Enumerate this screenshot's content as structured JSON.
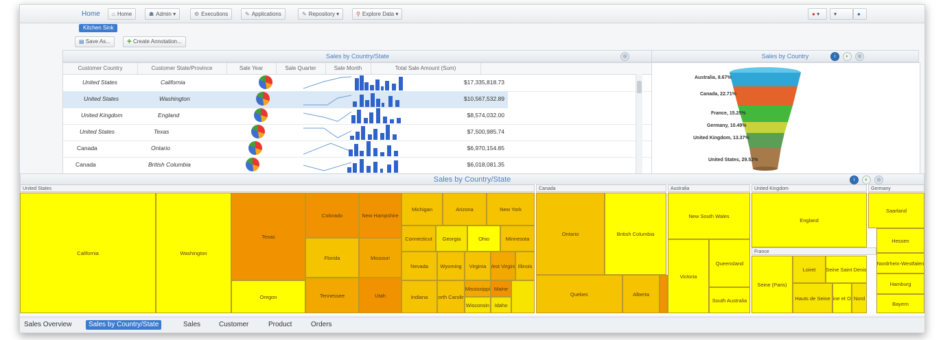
{
  "app": {
    "brand": "Home"
  },
  "nav": {
    "home": "Home",
    "admin": "Admin",
    "executions": "Executions",
    "applications": "Applications",
    "repository": "Repository",
    "explore": "Explore Data"
  },
  "kitchen_sink": "Kitchen Sink",
  "toolbar": {
    "save_as": "Save As...",
    "create_annotation": "Create Annotation..."
  },
  "grid_panel": {
    "title": "Sales by Country/State",
    "columns": [
      "Customer Country",
      "Customer State/Province",
      "Sale Year",
      "Sale Quarter",
      "Sale Month",
      "Total Sale Amount (Sum)"
    ],
    "rows": [
      {
        "country": "United States",
        "state": "California",
        "amount": "$17,335,818.73"
      },
      {
        "country": "United States",
        "state": "Washington",
        "amount": "$10,567,532.89"
      },
      {
        "country": "United Kingdom",
        "state": "England",
        "amount": "$8,574,032.00"
      },
      {
        "country": "United States",
        "state": "Texas",
        "amount": "$7,500,985.74"
      },
      {
        "country": "Canada",
        "state": "Ontario",
        "amount": "$6,970,154.85"
      },
      {
        "country": "Canada",
        "state": "British Columbia",
        "amount": "$6,018,081.35"
      }
    ]
  },
  "funnel_panel": {
    "title": "Sales by Country",
    "labels": [
      "Australia, 8.67%",
      "Canada, 22.71%",
      "France, 15.25%",
      "Germany, 10.49%",
      "United Kingdom, 13.37%",
      "United States, 29.52%"
    ],
    "colors": [
      "#2fa7d6",
      "#e3632b",
      "#44b83c",
      "#c7d33a",
      "#5b9e55",
      "#a77a4a"
    ]
  },
  "treemap_panel": {
    "title": "Sales by Country/State",
    "groups": [
      "United States",
      "Canada",
      "Australia",
      "United Kingdom",
      "Germany",
      "France"
    ],
    "cells": {
      "california": "California",
      "washington": "Washington",
      "texas": "Texas",
      "oregon": "Oregon",
      "colorado": "Colorado",
      "new_hampshire": "New Hampshire",
      "florida": "Florida",
      "missouri": "Missouri",
      "tennessee": "Tennessee",
      "utah": "Utah",
      "michigan": "Michigan",
      "arizona": "Arizona",
      "new_york": "New York",
      "connecticut": "Connecticut",
      "georgia": "Georgia",
      "ohio": "Ohio",
      "minnesota": "Minnesota",
      "nevada": "Nevada",
      "wyoming": "Wyoming",
      "virginia": "Virginia",
      "west_virginia": "West Virginia",
      "illinois": "Illinois",
      "indiana": "Indiana",
      "north_carolina": "North Carolina",
      "mississippi": "Mississippi",
      "maine": "Maine",
      "wisconsin": "Wisconsin",
      "idaho": "Idaho",
      "ontario": "Ontario",
      "british_columbia": "British Columbia",
      "quebec": "Quebec",
      "alberta": "Alberta",
      "new_south_wales": "New South Wales",
      "queensland": "Queensland",
      "victoria": "Victoria",
      "south_australia": "South Australia",
      "england": "England",
      "saarland": "Saarland",
      "hessen": "Hessen",
      "nordrhein": "Nordrhein-Westfalen",
      "hamburg": "Hamburg",
      "bayern": "Bayern",
      "loiret": "Loiret",
      "seine_paris": "Seine (Paris)",
      "seine_saint_denis": "Seine Saint Denis",
      "seine_et_oise": "Seine et Oise",
      "hauts_de_seine": "Hauts de Seine",
      "nord": "Nord"
    }
  },
  "tabs": [
    "Sales Overview",
    "Sales by Country/State",
    "Sales",
    "Customer",
    "Product",
    "Orders"
  ],
  "active_tab": "Sales by Country/State"
}
